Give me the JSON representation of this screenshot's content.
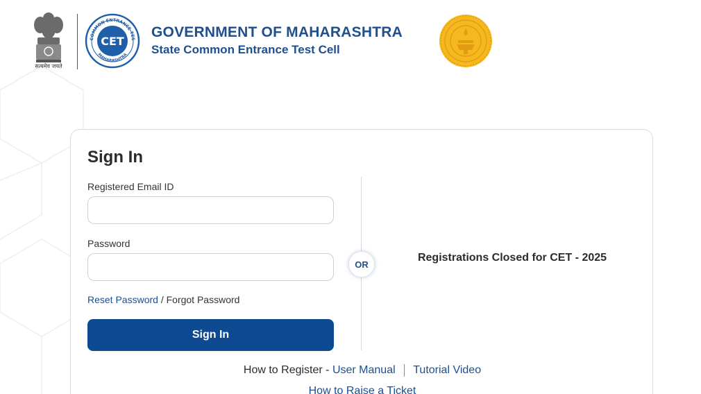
{
  "header": {
    "emblem_caption": "सत्यमेव जयते",
    "title": "GOVERNMENT OF MAHARASHTRA",
    "subtitle": "State Common Entrance Test Cell",
    "cet_logo": {
      "ring_text_top": "STATE COMMON ENTRANCE TEST CELL",
      "ring_text_bottom": "MAHARASHTRA",
      "center_text": "CET"
    }
  },
  "signin": {
    "title": "Sign In",
    "email_label": "Registered Email ID",
    "email_value": "",
    "password_label": "Password",
    "password_value": "",
    "reset_link": "Reset Password",
    "slash": "/",
    "forgot_link": "Forgot Password",
    "button_label": "Sign In"
  },
  "or_label": "OR",
  "notice": "Registrations Closed for CET - 2025",
  "help": {
    "prefix": "How to Register -",
    "user_manual": "User Manual",
    "tutorial_video": "Tutorial Video",
    "raise_ticket": "How to Raise a Ticket"
  },
  "colors": {
    "brand_blue": "#1f4f8f",
    "button_blue": "#0d4a92",
    "link_blue": "#1c4e91",
    "seal_gold": "#f0b21c"
  }
}
